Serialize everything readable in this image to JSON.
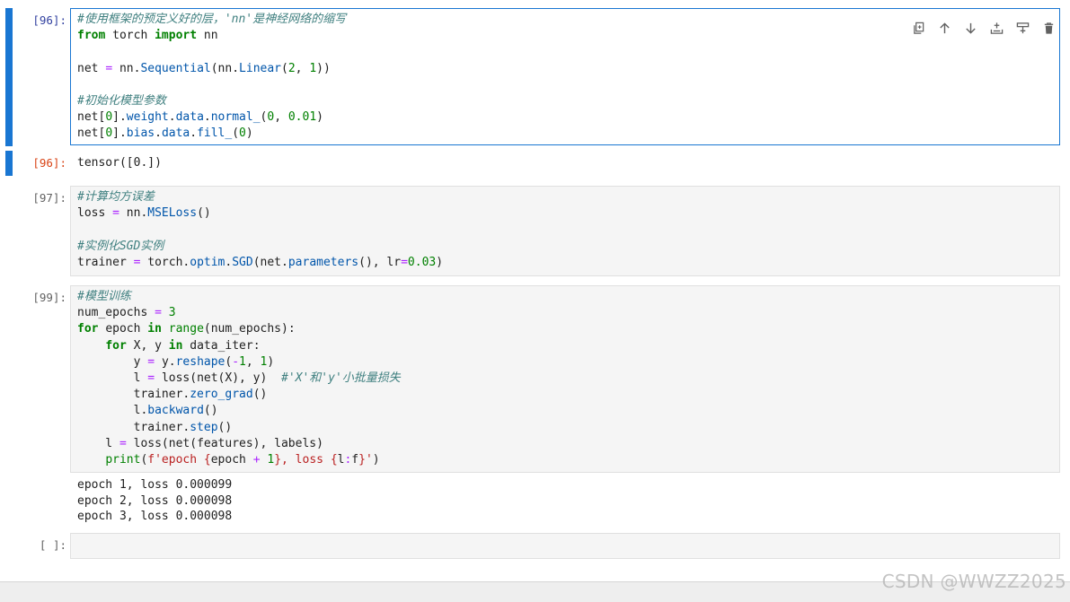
{
  "cells": [
    {
      "prompt": "[96]:",
      "code": [
        [
          [
            "cm",
            "#使用框架的预定义好的层，'nn'是神经网络的缩写"
          ]
        ],
        [
          [
            "kw",
            "from"
          ],
          [
            "",
            "torch"
          ],
          [
            "kw",
            "import"
          ],
          [
            "",
            "nn"
          ]
        ],
        [],
        [
          [
            "",
            "net"
          ],
          [
            "op",
            "="
          ],
          [
            "",
            "nn."
          ],
          [
            "attr",
            "Sequential"
          ],
          [
            "",
            "(nn."
          ],
          [
            "attr",
            "Linear"
          ],
          [
            "",
            "("
          ],
          [
            "num",
            "2"
          ],
          [
            "",
            ", "
          ],
          [
            "num",
            "1"
          ],
          [
            "",
            "))"
          ]
        ],
        [],
        [
          [
            "cm",
            "#初始化模型参数"
          ]
        ],
        [
          [
            "",
            "net["
          ],
          [
            "num",
            "0"
          ],
          [
            "",
            "]."
          ],
          [
            "attr",
            "weight"
          ],
          [
            "",
            "."
          ],
          [
            "attr",
            "data"
          ],
          [
            "",
            "."
          ],
          [
            "attr",
            "normal_"
          ],
          [
            "",
            "("
          ],
          [
            "num",
            "0"
          ],
          [
            "",
            ", "
          ],
          [
            "num",
            "0.01"
          ],
          [
            "",
            ")"
          ]
        ],
        [
          [
            "",
            "net["
          ],
          [
            "num",
            "0"
          ],
          [
            "",
            "]."
          ],
          [
            "attr",
            "bias"
          ],
          [
            "",
            "."
          ],
          [
            "attr",
            "data"
          ],
          [
            "",
            "."
          ],
          [
            "attr",
            "fill_"
          ],
          [
            "",
            "("
          ],
          [
            "num",
            "0"
          ],
          [
            "",
            ")"
          ]
        ]
      ]
    },
    {
      "prompt": "[97]:",
      "code": [
        [
          [
            "cm",
            "#计算均方误差"
          ]
        ],
        [
          [
            "",
            "loss"
          ],
          [
            "op",
            "="
          ],
          [
            "",
            "nn."
          ],
          [
            "attr",
            "MSELoss"
          ],
          [
            "",
            "()"
          ]
        ],
        [],
        [
          [
            "cm",
            "#实例化SGD实例"
          ]
        ],
        [
          [
            "",
            "trainer"
          ],
          [
            "op",
            "="
          ],
          [
            "",
            "torch."
          ],
          [
            "attr",
            "optim"
          ],
          [
            "",
            "."
          ],
          [
            "attr",
            "SGD"
          ],
          [
            "",
            "(net."
          ],
          [
            "attr",
            "parameters"
          ],
          [
            "",
            "(), lr"
          ],
          [
            "op",
            "="
          ],
          [
            "num",
            "0.03"
          ],
          [
            "",
            ")"
          ]
        ]
      ]
    },
    {
      "prompt": "[99]:",
      "code": [
        [
          [
            "cm",
            "#模型训练"
          ]
        ],
        [
          [
            "",
            "num_epochs"
          ],
          [
            "op",
            "="
          ],
          [
            "num",
            "3"
          ]
        ],
        [
          [
            "kw",
            "for"
          ],
          [
            "",
            "epoch"
          ],
          [
            "kw",
            "in"
          ],
          [
            "bi",
            "range"
          ],
          [
            "",
            "(num_epochs):"
          ]
        ],
        [
          [
            "",
            "    "
          ],
          [
            "kw",
            "for"
          ],
          [
            "",
            "X, y"
          ],
          [
            "kw",
            "in"
          ],
          [
            "",
            "data_iter:"
          ]
        ],
        [
          [
            "",
            "        y"
          ],
          [
            "op",
            "="
          ],
          [
            "",
            "y."
          ],
          [
            "attr",
            "reshape"
          ],
          [
            "",
            "("
          ],
          [
            "op",
            "-"
          ],
          [
            "num",
            "1"
          ],
          [
            "",
            ", "
          ],
          [
            "num",
            "1"
          ],
          [
            "",
            ")"
          ]
        ],
        [
          [
            "",
            "        l"
          ],
          [
            "op",
            "="
          ],
          [
            "",
            "loss(net(X), y)  "
          ],
          [
            "cm",
            "#'X'和'y'小批量损失"
          ]
        ],
        [
          [
            "",
            "        trainer."
          ],
          [
            "attr",
            "zero_grad"
          ],
          [
            "",
            "()"
          ]
        ],
        [
          [
            "",
            "        l."
          ],
          [
            "attr",
            "backward"
          ],
          [
            "",
            "()"
          ]
        ],
        [
          [
            "",
            "        trainer."
          ],
          [
            "attr",
            "step"
          ],
          [
            "",
            "()"
          ]
        ],
        [
          [
            "",
            "    l"
          ],
          [
            "op",
            "="
          ],
          [
            "",
            "loss(net(features), labels)"
          ]
        ],
        [
          [
            "",
            "    "
          ],
          [
            "bi",
            "print"
          ],
          [
            "",
            "("
          ],
          [
            "str",
            "f'epoch "
          ],
          [
            "str",
            "{"
          ],
          [
            "",
            "epoch"
          ],
          [
            "op",
            "+"
          ],
          [
            "num",
            "1"
          ],
          [
            "str",
            "}"
          ],
          [
            "str",
            ", loss "
          ],
          [
            "str",
            "{"
          ],
          [
            "",
            "l"
          ],
          [
            "op",
            ":"
          ],
          [
            "",
            "f"
          ],
          [
            "str",
            "}"
          ],
          [
            "str",
            "'"
          ],
          [
            "",
            ")"
          ]
        ]
      ]
    },
    {
      "prompt": "[ ]:",
      "code": []
    }
  ],
  "outputs": {
    "cell96": {
      "prompt": "[96]:",
      "text": "tensor([0.])"
    },
    "cell99": {
      "lines": [
        "epoch 1, loss 0.000099",
        "epoch 2, loss 0.000098",
        "epoch 3, loss 0.000098"
      ]
    }
  },
  "toolbar": {
    "icons": [
      "duplicate-icon",
      "move-up-icon",
      "move-down-icon",
      "insert-above-icon",
      "insert-below-icon",
      "delete-icon"
    ]
  },
  "watermark": "CSDN @WWZZ2025",
  "colors": {
    "active_border": "#1976d2",
    "keyword": "#008000",
    "comment": "#408080",
    "attribute": "#0055aa",
    "string": "#ba2121",
    "operator": "#aa22ff"
  }
}
